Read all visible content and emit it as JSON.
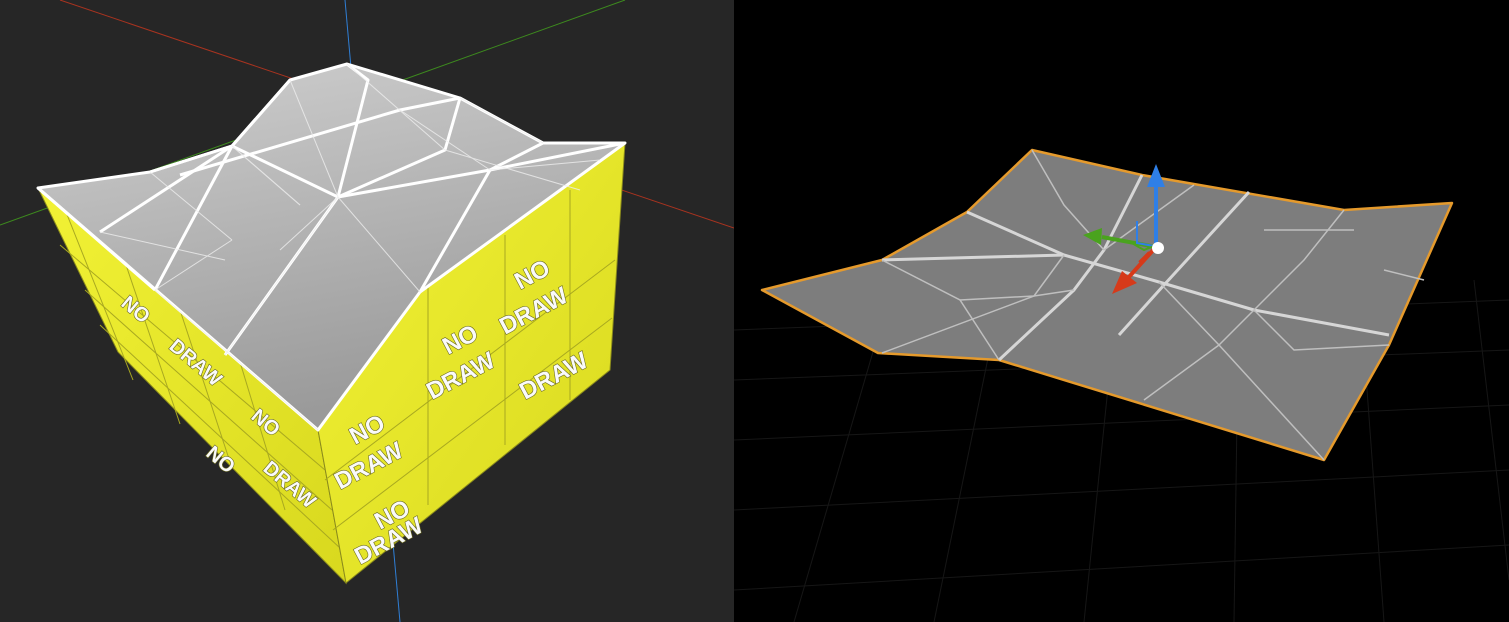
{
  "left_viewport": {
    "label": "perspective-viewport-left",
    "texture_text_line1": "NO",
    "texture_text_line2": "DRAW",
    "colors": {
      "background": "#262626",
      "x_axis": "#a8331f",
      "y_axis": "#3d8a1e",
      "z_axis": "#2f7fd6",
      "nodraw_yellow": "#ecec2a",
      "top_surface": "#b4b4b4",
      "edges": "#ffffff"
    }
  },
  "right_viewport": {
    "label": "perspective-viewport-right",
    "colors": {
      "background": "#000000",
      "grid": "#161616",
      "surface": "#7d7d7d",
      "selection_outline": "#e59a2c",
      "gizmo_x": "#d63a1a",
      "gizmo_y": "#4aa31e",
      "gizmo_z": "#2f7fe6",
      "gizmo_center": "#ffffff"
    }
  }
}
